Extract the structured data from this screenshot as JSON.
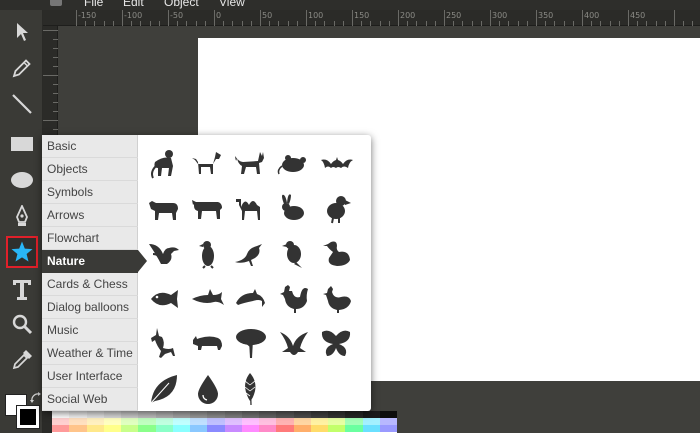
{
  "menubar": {
    "items": [
      {
        "label": "File"
      },
      {
        "label": "Edit"
      },
      {
        "label": "Object"
      },
      {
        "label": "View"
      }
    ]
  },
  "ruler": {
    "labels": [
      "-150",
      "-100",
      "-50",
      "0",
      "50",
      "100",
      "150",
      "200",
      "250",
      "300",
      "350",
      "400",
      "450"
    ]
  },
  "toolbar": {
    "tools": [
      {
        "name": "select-tool",
        "icon": "cursor-arrow-icon"
      },
      {
        "name": "pencil-tool",
        "icon": "pencil-icon"
      },
      {
        "name": "line-tool",
        "icon": "line-icon"
      },
      {
        "name": "rectangle-tool",
        "icon": "rectangle-icon"
      },
      {
        "name": "ellipse-tool",
        "icon": "ellipse-icon"
      },
      {
        "name": "path-tool",
        "icon": "pen-nib-icon"
      },
      {
        "name": "shape-library-tool",
        "icon": "star-icon",
        "active": true
      },
      {
        "name": "text-tool",
        "icon": "text-t-icon"
      },
      {
        "name": "zoom-tool",
        "icon": "magnifier-icon"
      },
      {
        "name": "eyedropper-tool",
        "icon": "eyedropper-icon"
      }
    ],
    "accent_color": "#29b6f6",
    "active_border_color": "#e0202a"
  },
  "colors": {
    "fill": "#ffffff",
    "stroke": "#000000"
  },
  "shape_library": {
    "categories": [
      {
        "label": "Basic"
      },
      {
        "label": "Objects"
      },
      {
        "label": "Symbols"
      },
      {
        "label": "Arrows"
      },
      {
        "label": "Flowchart"
      },
      {
        "label": "Nature",
        "selected": true
      },
      {
        "label": "Cards & Chess"
      },
      {
        "label": "Dialog balloons"
      },
      {
        "label": "Music"
      },
      {
        "label": "Weather & Time"
      },
      {
        "label": "User Interface"
      },
      {
        "label": "Social Web"
      }
    ],
    "shapes": [
      "monkey-icon",
      "dog-icon",
      "cat-icon",
      "mouse-icon",
      "bat-icon",
      "cow-icon",
      "bull-icon",
      "camel-icon",
      "rabbit-icon",
      "dodo-icon",
      "eagle-icon",
      "penguin-icon",
      "crow-icon",
      "raven-icon",
      "duck-icon",
      "fish-icon",
      "shark-icon",
      "dolphin-icon",
      "rooster-icon",
      "hen-icon",
      "unicorn-icon",
      "rhino-icon",
      "tree-icon",
      "bird-flying-icon",
      "butterfly-icon",
      "leaf-icon",
      "water-drop-icon",
      "feather-icon"
    ]
  }
}
